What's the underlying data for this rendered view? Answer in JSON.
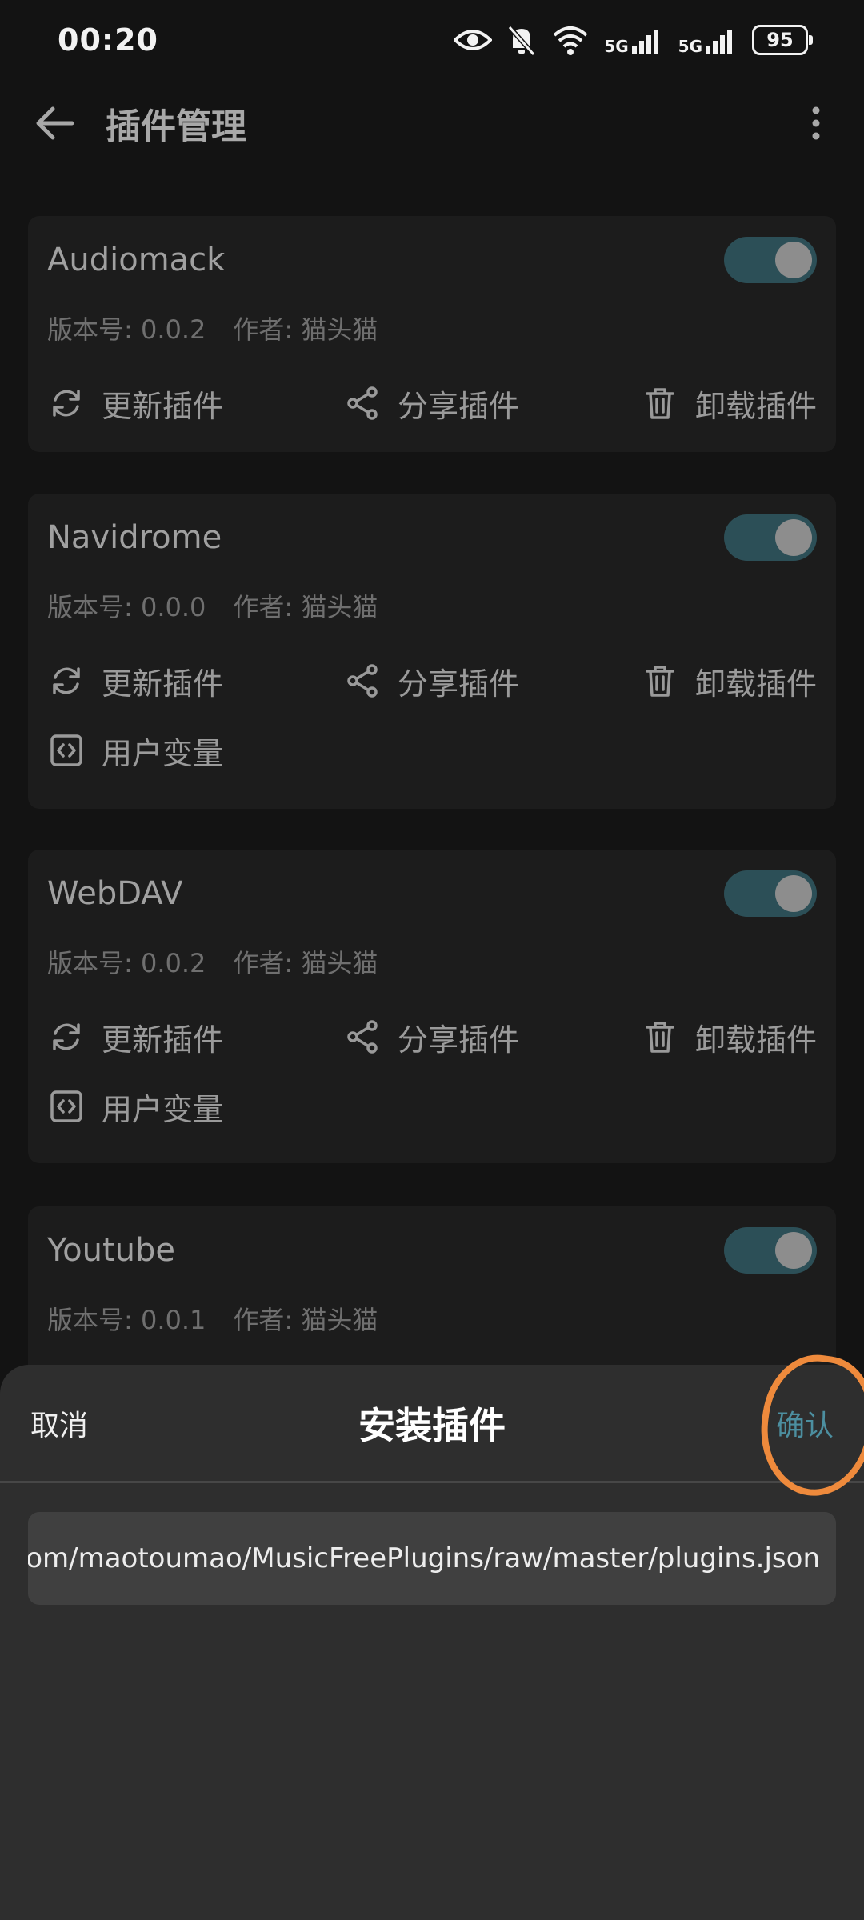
{
  "status_bar": {
    "time": "00:20",
    "net1": "5G",
    "net2": "5G",
    "battery": "95"
  },
  "appbar": {
    "title": "插件管理"
  },
  "plugins": [
    {
      "name": "Audiomack",
      "version": "版本号: 0.0.2",
      "author": "作者: 猫头猫",
      "enabled": true,
      "update": "更新插件",
      "share": "分享插件",
      "uninstall": "卸载插件"
    },
    {
      "name": "Navidrome",
      "version": "版本号: 0.0.0",
      "author": "作者: 猫头猫",
      "enabled": true,
      "update": "更新插件",
      "share": "分享插件",
      "uninstall": "卸载插件",
      "variables": "用户变量"
    },
    {
      "name": "WebDAV",
      "version": "版本号: 0.0.2",
      "author": "作者: 猫头猫",
      "enabled": true,
      "update": "更新插件",
      "share": "分享插件",
      "uninstall": "卸载插件",
      "variables": "用户变量"
    },
    {
      "name": "Youtube",
      "version": "版本号: 0.0.1",
      "author": "作者: 猫头猫",
      "enabled": true
    }
  ],
  "sheet": {
    "cancel": "取消",
    "title": "安装插件",
    "confirm": "确认",
    "url_value": "'/gitee.com/maotoumao/MusicFreePlugins/raw/master/plugins.json"
  },
  "colors": {
    "toggle_track": "#2c4f57",
    "accent": "#4c8fa0",
    "annotation": "#ee8a3c"
  }
}
